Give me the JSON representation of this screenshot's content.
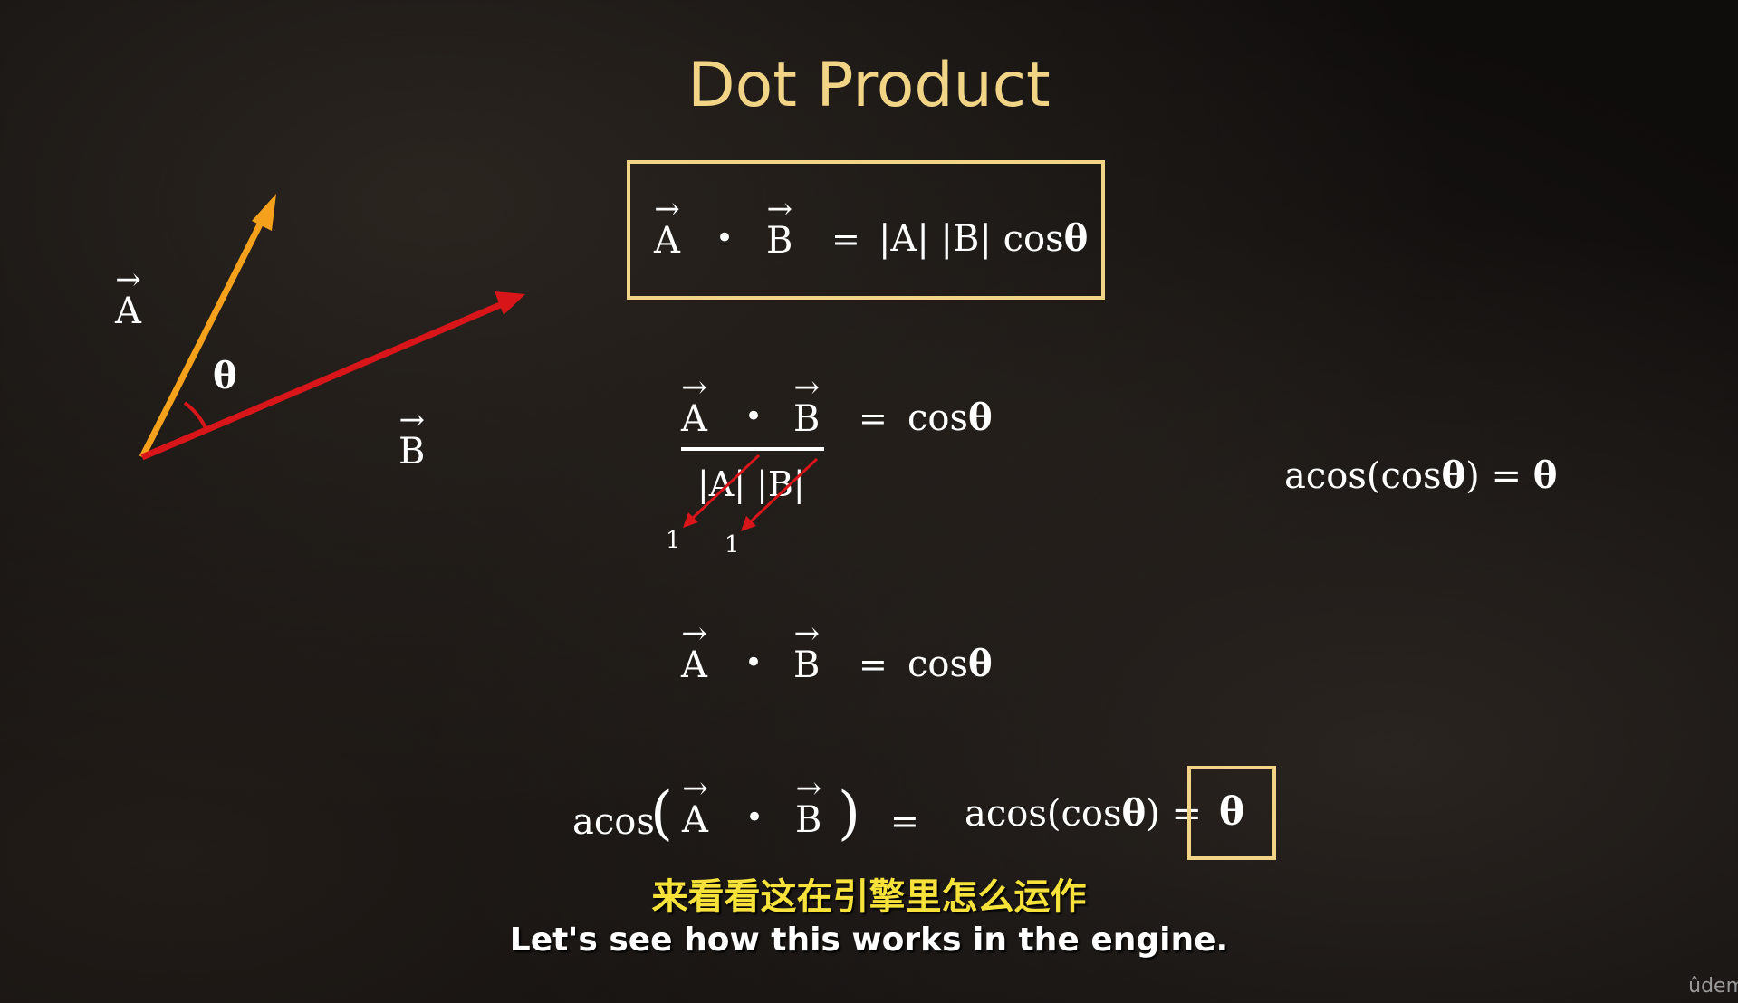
{
  "title": "Dot Product",
  "diagram": {
    "vector_a": "A",
    "vector_b": "B",
    "angle": "θ",
    "arrow": "→",
    "colors": {
      "a": "#f5a11c",
      "b": "#d8161a"
    }
  },
  "eq1": {
    "a": "A",
    "dot": "•",
    "b": "B",
    "equals": "=",
    "rhs": "|A| |B| cos",
    "theta": "θ"
  },
  "eq2": {
    "a": "A",
    "dot": "•",
    "b": "B",
    "equals": "=",
    "rhs": "cos",
    "theta": "θ",
    "denominator": "|A| |B|",
    "one_a": "1",
    "one_b": "1"
  },
  "side_eq": {
    "lhs": "acos(cos",
    "theta": "θ",
    "mid": ") = ",
    "rhs": "θ"
  },
  "eq3": {
    "a": "A",
    "dot": "•",
    "b": "B",
    "equals": "=",
    "rhs": "cos",
    "theta": "θ"
  },
  "eq4": {
    "acos": "acos",
    "open": "(",
    "a": "A",
    "dot": "•",
    "b": "B",
    "close": ")",
    "equals": "=",
    "mid": "acos(cos",
    "theta": "θ",
    "mid_close": ") =",
    "result": "θ"
  },
  "subtitles": {
    "zh": "来看看这在引擎里怎么运作",
    "en": "Let's see how this works in the engine."
  },
  "logo": "ûdem"
}
